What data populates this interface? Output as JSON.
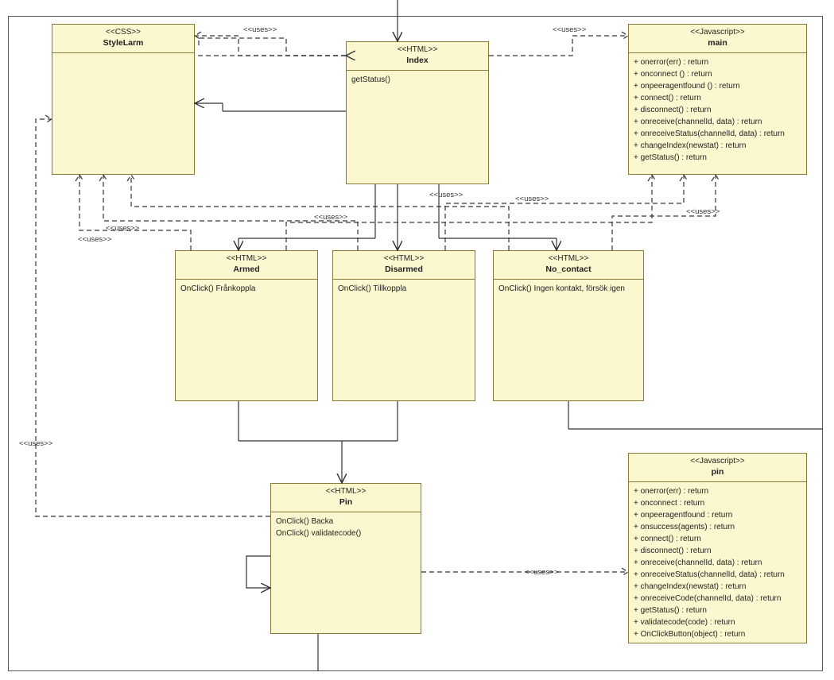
{
  "labels": {
    "uses": "<<uses>>"
  },
  "classes": {
    "styleLarm": {
      "stereo": "<<CSS>>",
      "name": "StyleLarm",
      "body": []
    },
    "index": {
      "stereo": "<<HTML>>",
      "name": "Index",
      "body": [
        "getStatus()"
      ]
    },
    "main": {
      "stereo": "<<Javascript>>",
      "name": "main",
      "body": [
        "+ onerror(err) : return",
        "+ onconnect () : return",
        "+ onpeeragentfound () : return",
        "+ connect() : return",
        "+ disconnect() : return",
        "+ onreceive(channelId, data) : return",
        "+ onreceiveStatus(channelId, data) : return",
        "+ changeIndex(newstat)  : return",
        "+ getStatus() : return"
      ]
    },
    "armed": {
      "stereo": "<<HTML>>",
      "name": "Armed",
      "body": [
        "OnClick() Frånkoppla"
      ]
    },
    "disarmed": {
      "stereo": "<<HTML>>",
      "name": "Disarmed",
      "body": [
        "OnClick() Tillkoppla"
      ]
    },
    "noContact": {
      "stereo": "<<HTML>>",
      "name": "No_contact",
      "body": [
        "OnClick() Ingen kontakt, försök igen"
      ]
    },
    "pin": {
      "stereo": "<<HTML>>",
      "name": "Pin",
      "body": [
        "OnClick() Backa",
        "OnClick() validatecode()"
      ]
    },
    "pinJs": {
      "stereo": "<<Javascript>>",
      "name": "pin",
      "body": [
        "+ onerror(err) : return",
        "+ onconnect : return",
        "+ onpeeragentfound : return",
        "+ onsuccess(agents) : return",
        "+ connect() : return",
        "+ disconnect() : return",
        "+ onreceive(channelId, data) : return",
        "+ onreceiveStatus(channelId, data) : return",
        "+ changeIndex(newstat) : return",
        "+ onreceiveCode(channelId, data) : return",
        "+ getStatus() : return",
        "+ validatecode(code) : return",
        "+ OnClickButton(object) : return"
      ]
    }
  }
}
